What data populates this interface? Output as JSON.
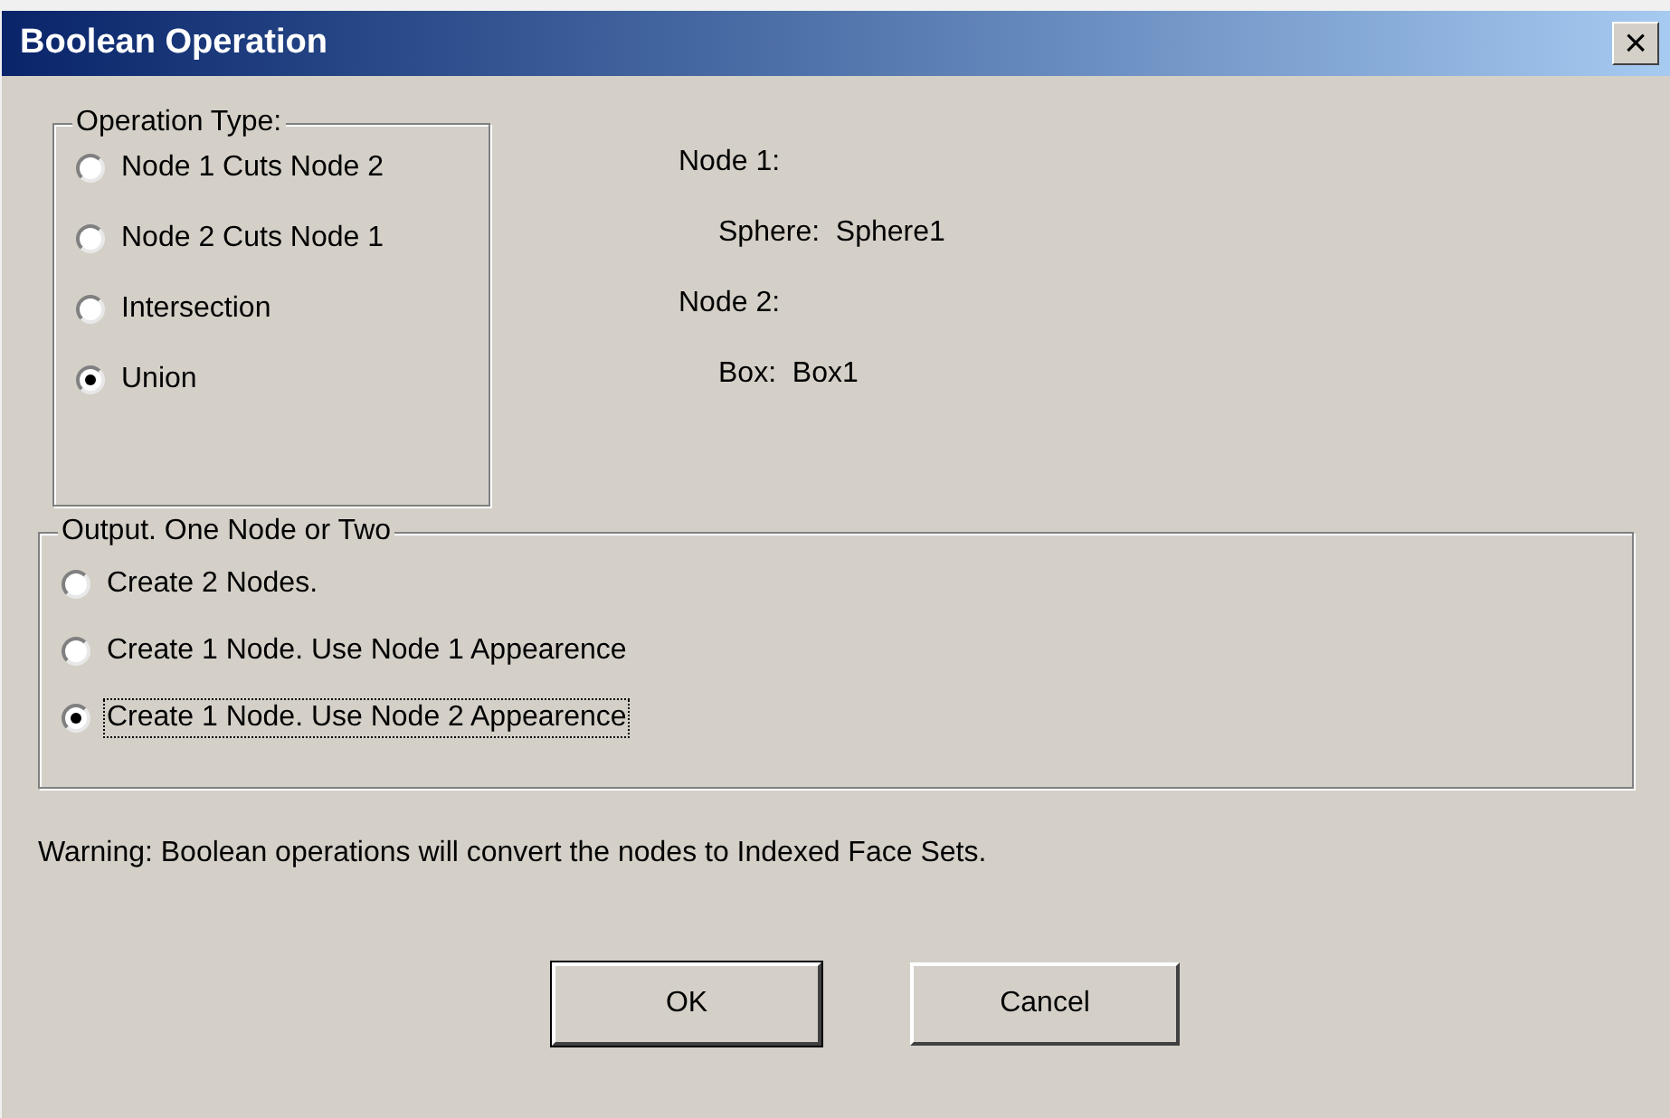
{
  "window": {
    "title": "Boolean Operation",
    "close": "×"
  },
  "operation_type": {
    "label": "Operation Type:",
    "options": [
      {
        "label": "Node 1 Cuts Node 2",
        "selected": false
      },
      {
        "label": "Node 2 Cuts Node 1",
        "selected": false
      },
      {
        "label": "Intersection",
        "selected": false
      },
      {
        "label": "Union",
        "selected": true
      }
    ]
  },
  "nodes": [
    {
      "label": "Node 1:",
      "value": "Sphere:  Sphere1"
    },
    {
      "label": "Node 2:",
      "value": "Box:  Box1"
    }
  ],
  "output": {
    "label": "Output.  One Node or Two",
    "options": [
      {
        "label": "Create 2 Nodes.",
        "selected": false,
        "focused": false
      },
      {
        "label": "Create 1 Node.  Use Node 1 Appearence",
        "selected": false,
        "focused": false
      },
      {
        "label": "Create 1 Node.  Use Node 2 Appearence",
        "selected": true,
        "focused": true
      }
    ]
  },
  "warning": "Warning:  Boolean operations will convert the nodes to Indexed Face Sets.",
  "buttons": [
    {
      "label": "OK",
      "default": true
    },
    {
      "label": "Cancel",
      "default": false
    }
  ]
}
